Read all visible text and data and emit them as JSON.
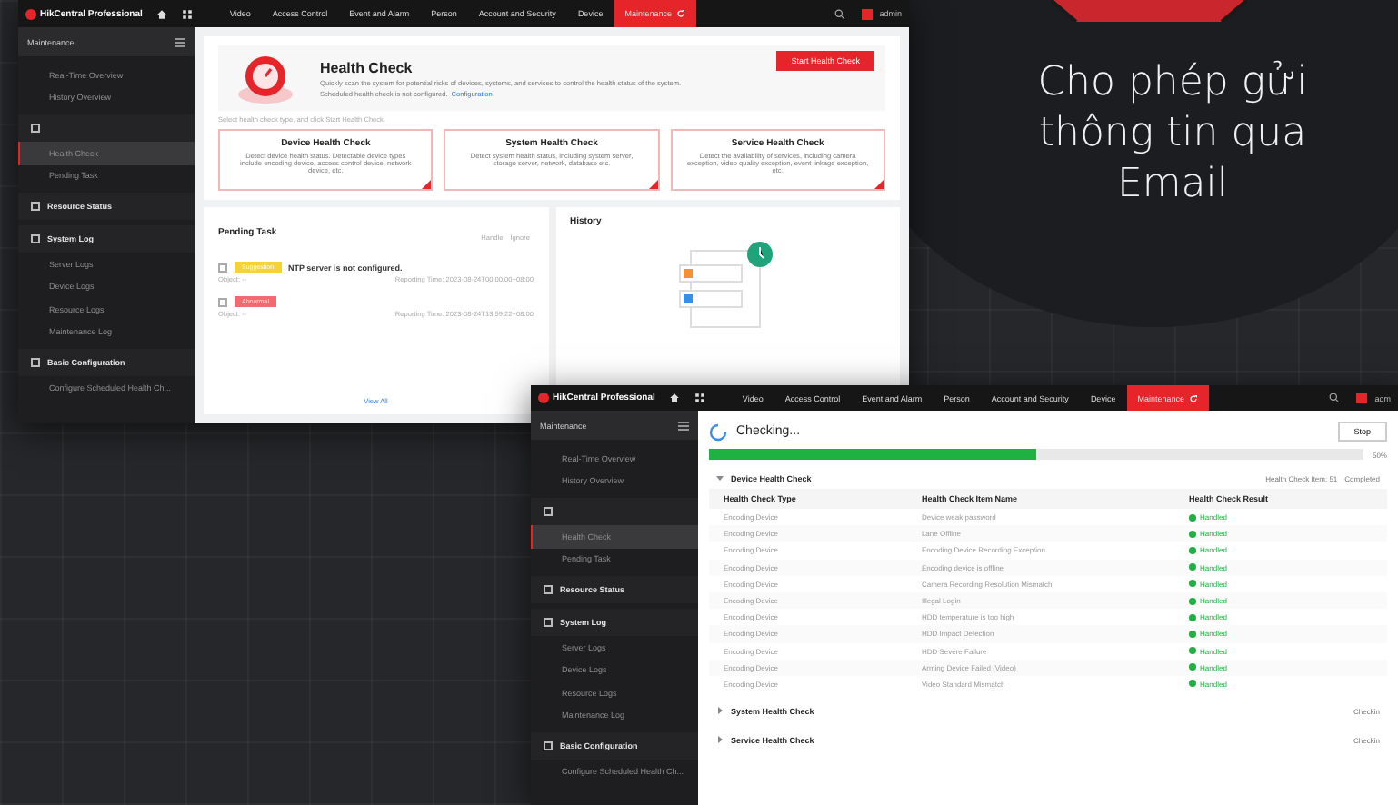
{
  "headline": "Cho phép gửi thông tin qua Email",
  "windows": [
    {
      "app": "HikCentral Professional",
      "user": "admin",
      "nav": [
        {
          "label": "Video",
          "selected": false
        },
        {
          "label": "Access Control",
          "selected": false
        },
        {
          "label": "Event and Alarm",
          "selected": false
        },
        {
          "label": "Person",
          "selected": false
        },
        {
          "label": "Account and Security",
          "selected": false
        },
        {
          "label": "Device",
          "selected": false
        },
        {
          "label": "Maintenance",
          "selected": true
        }
      ],
      "sidebar": {
        "title": "Maintenance",
        "items": [
          {
            "kind": "item",
            "label": "Real-Time Overview",
            "selected": false
          },
          {
            "kind": "item",
            "label": "History Overview",
            "selected": false
          },
          {
            "kind": "group",
            "selected": false
          },
          {
            "kind": "item",
            "label": "Health Check",
            "selected": true
          },
          {
            "kind": "item",
            "label": "Pending Task",
            "selected": false
          },
          {
            "kind": "group",
            "label": "Resource Status",
            "selected": false
          },
          {
            "kind": "group",
            "label": "System Log",
            "selected": false
          },
          {
            "kind": "item",
            "label": "Server Logs",
            "selected": false
          },
          {
            "kind": "item",
            "label": "Device Logs",
            "selected": false
          },
          {
            "kind": "item",
            "label": "Resource Logs",
            "selected": false
          },
          {
            "kind": "item",
            "label": "Maintenance Log",
            "selected": false
          },
          {
            "kind": "group",
            "label": "Basic Configuration",
            "selected": false
          },
          {
            "kind": "item",
            "label": "Configure Scheduled Health Ch...",
            "selected": false
          }
        ]
      },
      "kind": "overview",
      "header": {
        "title": "Health Check",
        "description": "Quickly scan the system for potential risks of devices, systems, and services to control the health status of the system.",
        "schedule": "Scheduled health check is not configured.",
        "schedule_link": "Configuration",
        "button": "Start Health Check"
      },
      "hint": "Select health check type, and click Start Health Check.",
      "cards": [
        {
          "title": "Device Health Check",
          "text": "Detect device health status. Detectable device types include encoding device, access control device, network device, etc."
        },
        {
          "title": "System Health Check",
          "text": "Detect system health status, including system server, storage server, network, database etc."
        },
        {
          "title": "Service Health Check",
          "text": "Detect the availability of services, including camera exception, video quality exception, event linkage exception, etc."
        }
      ],
      "pending": {
        "title": "Pending Task",
        "actions": [
          "Handle",
          "Ignore"
        ],
        "tasks": [
          {
            "checked": false,
            "tag": "Suggestion",
            "color": "#f5d238",
            "text": "NTP server is not configured.",
            "object": "Object: --",
            "time": "Reporting Time: 2023-08-24T00:00:00+08:00"
          },
          {
            "checked": false,
            "tag": "Abnormal",
            "color": "#f06a6e",
            "object": "Object: --",
            "time": "Reporting Time: 2023-08-24T13:59:22+08:00"
          }
        ],
        "more": "View All"
      },
      "history": {
        "title": "History"
      }
    },
    {
      "app": "HikCentral Professional",
      "user": "adm",
      "nav": [
        {
          "label": "Video",
          "selected": false
        },
        {
          "label": "Access Control",
          "selected": false
        },
        {
          "label": "Event and Alarm",
          "selected": false
        },
        {
          "label": "Person",
          "selected": false
        },
        {
          "label": "Account and Security",
          "selected": false
        },
        {
          "label": "Device",
          "selected": false
        },
        {
          "label": "Maintenance",
          "selected": true
        }
      ],
      "sidebar": {
        "title": "Maintenance",
        "items": [
          {
            "kind": "item",
            "label": "Real-Time Overview",
            "selected": false
          },
          {
            "kind": "item",
            "label": "History Overview",
            "selected": false
          },
          {
            "kind": "group",
            "selected": false
          },
          {
            "kind": "item",
            "label": "Health Check",
            "selected": true
          },
          {
            "kind": "item",
            "label": "Pending Task",
            "selected": false
          },
          {
            "kind": "group",
            "label": "Resource Status",
            "selected": false
          },
          {
            "kind": "group",
            "label": "System Log",
            "selected": false
          },
          {
            "kind": "item",
            "label": "Server Logs",
            "selected": false
          },
          {
            "kind": "item",
            "label": "Device Logs",
            "selected": false
          },
          {
            "kind": "item",
            "label": "Resource Logs",
            "selected": false
          },
          {
            "kind": "item",
            "label": "Maintenance Log",
            "selected": false
          },
          {
            "kind": "group",
            "label": "Basic Configuration",
            "selected": false
          },
          {
            "kind": "item",
            "label": "Configure Scheduled Health Ch...",
            "selected": false
          }
        ]
      },
      "kind": "checking",
      "status": "Checking...",
      "button": "Stop",
      "progress": {
        "level": 0.5,
        "reading": "50%"
      },
      "sections": [
        {
          "title": "Device Health Check",
          "expanded": true,
          "summary": "Health Check Item: 51",
          "state": "Completed",
          "columns": [
            "Health Check Type",
            "Health Check Item Name",
            "Health Check Result"
          ],
          "rows": [
            [
              "Encoding Device",
              "Device weak password",
              "Handled"
            ],
            [
              "Encoding Device",
              "Lane Offline",
              "Handled"
            ],
            [
              "Encoding Device",
              "Encoding Device Recording Exception",
              "Handled"
            ],
            [
              "Encoding Device",
              "Encoding device is offline",
              "Handled"
            ],
            [
              "Encoding Device",
              "Camera Recording Resolution Mismatch",
              "Handled"
            ],
            [
              "Encoding Device",
              "Illegal Login",
              "Handled"
            ],
            [
              "Encoding Device",
              "HDD temperature is too high",
              "Handled"
            ],
            [
              "Encoding Device",
              "HDD Impact Detection",
              "Handled"
            ],
            [
              "Encoding Device",
              "HDD Severe Failure",
              "Handled"
            ],
            [
              "Encoding Device",
              "Arming Device Failed (Video)",
              "Handled"
            ],
            [
              "Encoding Device",
              "Video Standard Mismatch",
              "Handled"
            ]
          ]
        },
        {
          "title": "System Health Check",
          "expanded": false,
          "state": "Checkin"
        },
        {
          "title": "Service Health Check",
          "expanded": false,
          "state": "Checkin"
        }
      ]
    }
  ]
}
